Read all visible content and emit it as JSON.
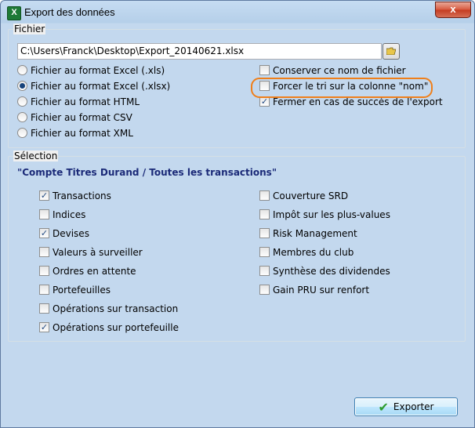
{
  "window": {
    "title": "Export des données",
    "close_label": "x",
    "app_icon_letter": "X"
  },
  "fichier": {
    "legend": "Fichier",
    "path_value": "C:\\Users\\Franck\\Desktop\\Export_20140621.xlsx",
    "formats": [
      {
        "label": "Fichier au format Excel (.xls)",
        "selected": false
      },
      {
        "label": "Fichier au format Excel (.xlsx)",
        "selected": true
      },
      {
        "label": "Fichier au format HTML",
        "selected": false
      },
      {
        "label": "Fichier au format CSV",
        "selected": false
      },
      {
        "label": "Fichier au format XML",
        "selected": false
      }
    ],
    "options": [
      {
        "label": "Conserver ce nom de fichier",
        "checked": false
      },
      {
        "label": "Forcer le tri sur la colonne \"nom\"",
        "checked": false
      },
      {
        "label": "Fermer en cas de succès de l'export",
        "checked": true
      }
    ]
  },
  "selection": {
    "legend": "Sélection",
    "title": "\"Compte Titres Durand / Toutes les transactions\"",
    "left_items": [
      {
        "label": "Transactions",
        "checked": true
      },
      {
        "label": "Indices",
        "checked": false
      },
      {
        "label": "Devises",
        "checked": true
      },
      {
        "label": "Valeurs à surveiller",
        "checked": false
      },
      {
        "label": "Ordres en attente",
        "checked": false
      },
      {
        "label": "Portefeuilles",
        "checked": false
      },
      {
        "label": "Opérations sur transaction",
        "checked": false
      },
      {
        "label": "Opérations sur portefeuille",
        "checked": true
      }
    ],
    "right_items": [
      {
        "label": "Couverture SRD",
        "checked": false
      },
      {
        "label": "Impôt sur les plus-values",
        "checked": false
      },
      {
        "label": "Risk Management",
        "checked": false
      },
      {
        "label": "Membres du club",
        "checked": false
      },
      {
        "label": "Synthèse des dividendes",
        "checked": false
      },
      {
        "label": "Gain PRU sur renfort",
        "checked": false
      }
    ]
  },
  "footer": {
    "export_label": "Exporter"
  },
  "colors": {
    "accent_highlight": "#ef7f1a",
    "selection_title": "#1b2a78",
    "check_icon": "#2e9c2e"
  }
}
